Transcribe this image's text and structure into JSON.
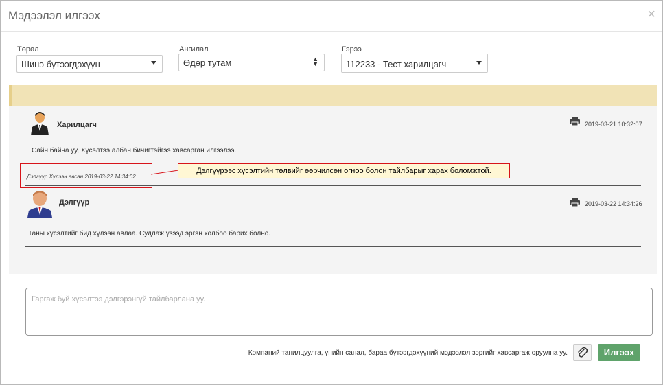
{
  "modal": {
    "title": "Мэдээлэл илгээх",
    "close": "×"
  },
  "form": {
    "type_label": "Төрөл",
    "type_value": "Шинэ бүтээгдэхүүн",
    "category_label": "Ангилал",
    "category_value": "Өдөр тутам",
    "contract_label": "Гэрээ",
    "contract_value": "112233 - Тест харилцагч"
  },
  "messages": [
    {
      "sender": "Харилцагч",
      "date": "2019-03-21 10:32:07",
      "body": "Сайн байна уу, Хүсэлтээ албан бичигтэйгээ хавсарган илгээлээ.",
      "edit_note": "Дэлгүүр Хүлээн авсан 2019-03-22 14:34:02"
    },
    {
      "sender": "Дэлгүүр",
      "date": "2019-03-22 14:34:26",
      "body": "Таны хүсэлтийг бид хүлээн авлаа. Судлаж үзээд эргэн холбоо барих болно."
    }
  ],
  "callout": "Дэлгүүрээс хүсэлтийн төлвийг өөрчилсөн огноо болон тайлбарыг харах боломжтой.",
  "reply": {
    "placeholder": "Гаргаж буй хүсэлтээ дэлгэрэнгүй тайлбарлана уу.",
    "attach_hint": "Компаний танилцуулга, үнийн санал, бараа бүтээгдэхүүний мэдээлэл зэргийг хавсаргаж оруулна уу.",
    "send_label": "Илгээх"
  },
  "colors": {
    "alert": "#f1e3b6",
    "send": "#5fa36b",
    "highlight": "#d7141a"
  }
}
